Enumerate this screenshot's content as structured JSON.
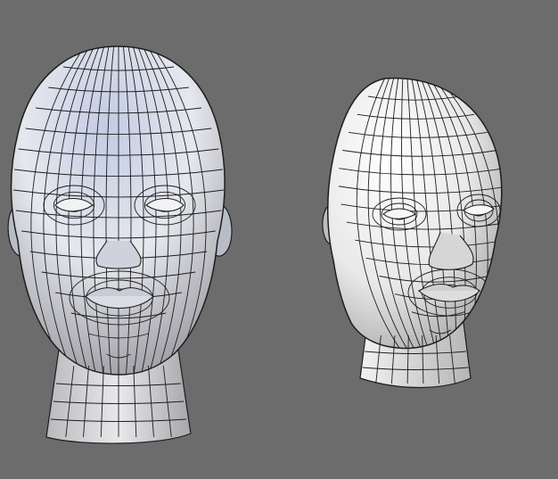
{
  "scene": {
    "background_color": "#6c6c6c",
    "models": [
      {
        "name": "head-mesh-front",
        "view": "front",
        "shading": "smooth-with-wireframe",
        "surface_color": "#dadfea",
        "tint_color": "#b4bedc",
        "wire_color": "#1e1e1e"
      },
      {
        "name": "head-mesh-three-quarter",
        "view": "three-quarter",
        "shading": "smooth-with-wireframe",
        "surface_color": "#ededed",
        "tint_color": "#c9c9c9",
        "wire_color": "#1e1e1e"
      }
    ]
  }
}
